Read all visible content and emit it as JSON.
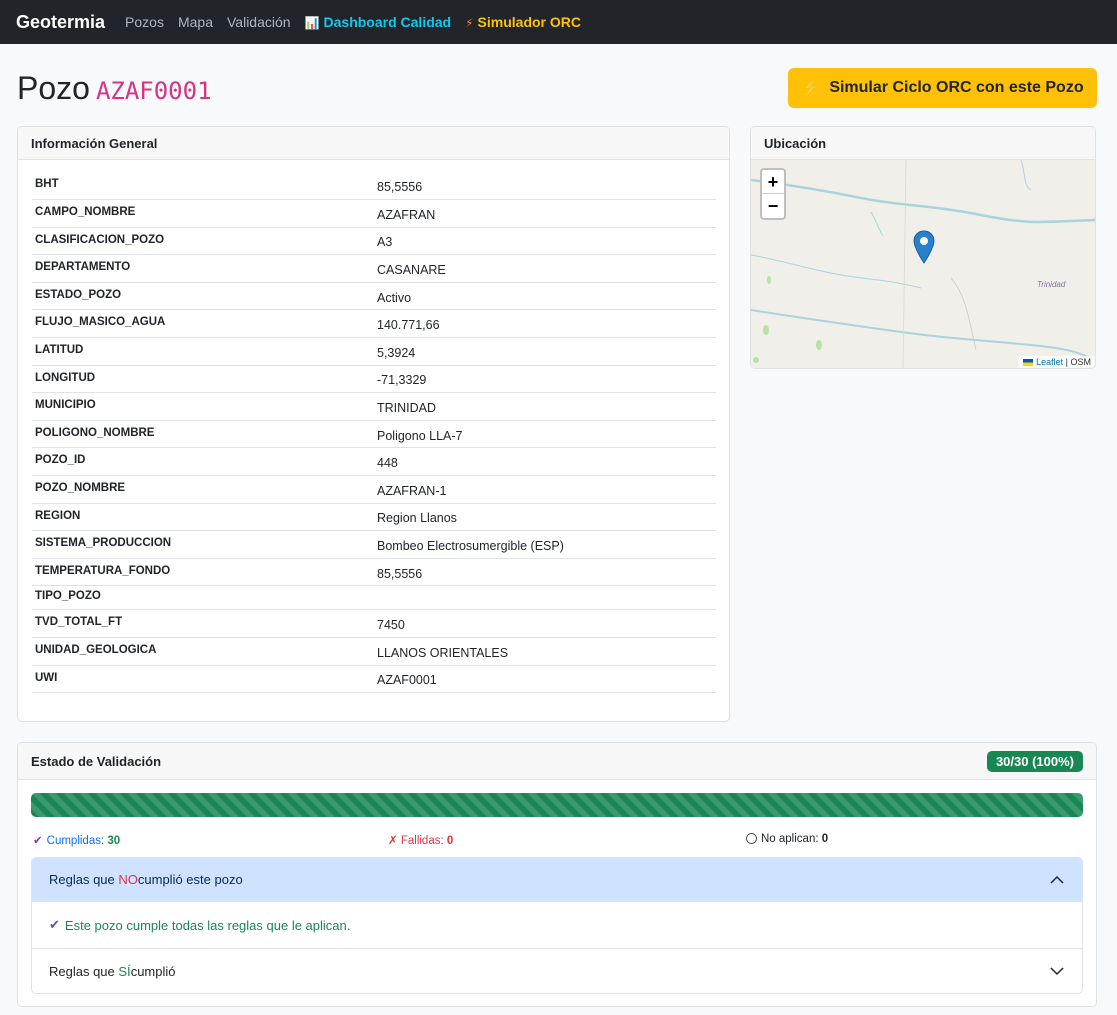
{
  "nav": {
    "brand": "Geotermia",
    "links": [
      "Pozos",
      "Mapa",
      "Validación"
    ],
    "dashboard": "Dashboard Calidad",
    "simulator": "Simulador ORC"
  },
  "page": {
    "title_prefix": "Pozo",
    "code": "AZAF0001",
    "simulate_button": "Simular Ciclo ORC con este Pozo"
  },
  "info": {
    "header": "Información General",
    "rows": [
      {
        "key": "BHT",
        "value": "85,5556"
      },
      {
        "key": "CAMPO_NOMBRE",
        "value": "AZAFRAN"
      },
      {
        "key": "CLASIFICACION_POZO",
        "value": "A3"
      },
      {
        "key": "DEPARTAMENTO",
        "value": "CASANARE"
      },
      {
        "key": "ESTADO_POZO",
        "value": "Activo"
      },
      {
        "key": "FLUJO_MASICO_AGUA",
        "value": "140.771,66"
      },
      {
        "key": "LATITUD",
        "value": "5,3924"
      },
      {
        "key": "LONGITUD",
        "value": "-71,3329"
      },
      {
        "key": "MUNICIPIO",
        "value": "TRINIDAD"
      },
      {
        "key": "POLIGONO_NOMBRE",
        "value": "Poligono LLA-7"
      },
      {
        "key": "POZO_ID",
        "value": "448"
      },
      {
        "key": "POZO_NOMBRE",
        "value": "AZAFRAN-1"
      },
      {
        "key": "REGION",
        "value": "Region Llanos"
      },
      {
        "key": "SISTEMA_PRODUCCION",
        "value": "Bombeo Electrosumergible (ESP)"
      },
      {
        "key": "TEMPERATURA_FONDO",
        "value": "85,5556"
      },
      {
        "key": "TIPO_POZO",
        "value": ""
      },
      {
        "key": "TVD_TOTAL_FT",
        "value": "7450"
      },
      {
        "key": "UNIDAD_GEOLOGICA",
        "value": "LLANOS ORIENTALES"
      },
      {
        "key": "UWI",
        "value": "AZAF0001"
      }
    ]
  },
  "map": {
    "header": "Ubicación",
    "zoom_in": "+",
    "zoom_out": "−",
    "place_label": "Trinidad",
    "attribution_leaflet": "Leaflet",
    "attribution_sep": " | ",
    "attribution_osm": "OSM"
  },
  "validation": {
    "header": "Estado de Validación",
    "badge": "30/30 (100%)",
    "progress": 1.0,
    "passed_label": "Cumplidas:",
    "passed": "30",
    "failed_label": "Fallidas:",
    "failed": "0",
    "na_label": "No aplican:",
    "na": "0",
    "failed_rules_head_a": "Reglas que ",
    "failed_rules_head_b": "NO",
    "failed_rules_head_c": "cumplió este pozo",
    "all_passed_msg": "Este pozo cumple todas las reglas que le aplican.",
    "passed_rules_head_a": "Reglas que ",
    "passed_rules_head_b": "SÍ",
    "passed_rules_head_c": "cumplió"
  },
  "colors": {
    "navbar": "#212529",
    "accent_warning": "#ffc107",
    "success": "#198754",
    "info": "#0dcaf0",
    "code": "#d63384"
  }
}
